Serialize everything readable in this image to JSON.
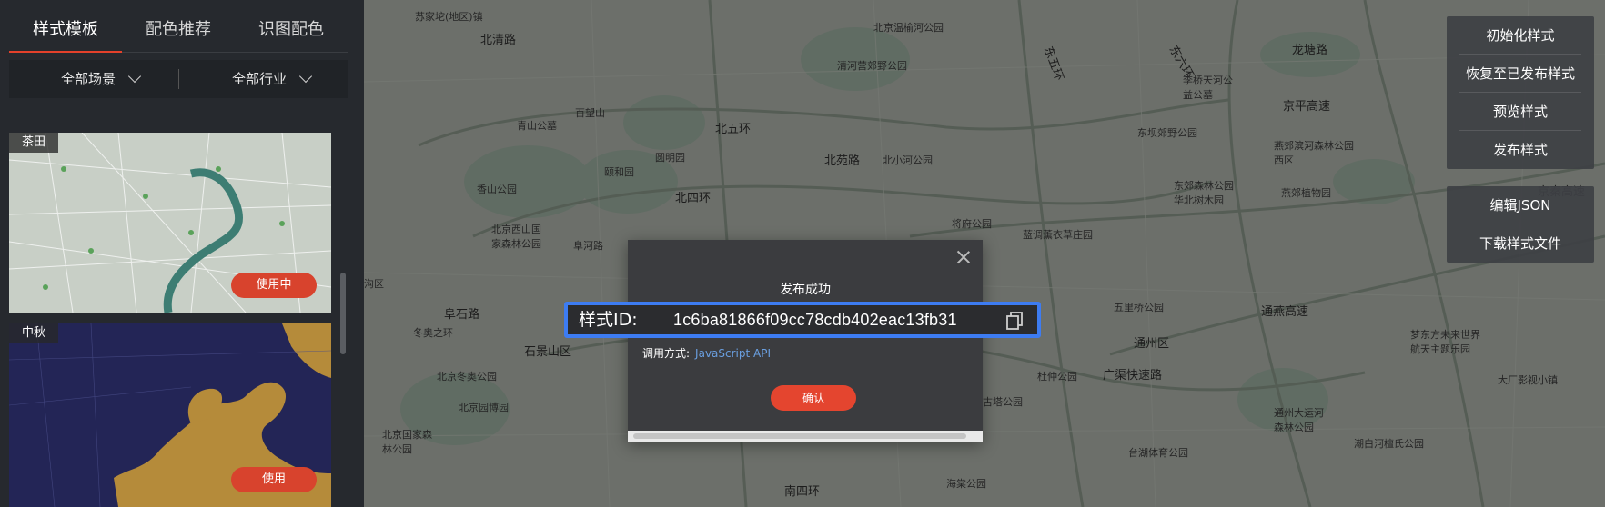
{
  "sidebar": {
    "tabs": [
      {
        "label": "样式模板"
      },
      {
        "label": "配色推荐"
      },
      {
        "label": "识图配色"
      }
    ],
    "filters": [
      {
        "label": "全部场景"
      },
      {
        "label": "全部行业"
      }
    ],
    "cards": [
      {
        "tag": "茶田",
        "button": "使用中"
      },
      {
        "tag": "中秋",
        "button": "使用"
      }
    ]
  },
  "map": {
    "labels": [
      "苏家坨(地区)镇",
      "北清路",
      "百望山",
      "青山公墓",
      "颐和园",
      "圆明园",
      "北五环",
      "北四环",
      "香山公园",
      "北京西山国家森林公园",
      "阜河路",
      "石景山区",
      "冬奥之环",
      "阜石路",
      "北京冬奥公园",
      "北京国家森林公园",
      "北京园博园",
      "北苑路",
      "北小河公园",
      "北京温榆河公园",
      "清河营郊野公园",
      "东坝郊野公园",
      "东郊森林公园",
      "华北树木园",
      "京平高速",
      "龙塘路",
      "李桥天河公益公墓",
      "将府公园",
      "蓝调薰衣草庄园",
      "五里桥公园",
      "通燕高速",
      "通州区",
      "梦东方未来世界航天主题乐园",
      "大厂影视小镇",
      "广渠快速路",
      "杜仲公园",
      "古塔公园",
      "台湖体育公园",
      "海棠公园",
      "南四环",
      "通州大运河森林公园",
      "潮白河檀氏公园",
      "燕郊植物园",
      "京秦高速",
      "燕郊滨河森林公园西区",
      "沟区",
      "东六环",
      "东五环"
    ]
  },
  "panels": {
    "style_actions": [
      "初始化样式",
      "恢复至已发布样式",
      "预览样式",
      "发布样式"
    ],
    "file_actions": [
      "编辑JSON",
      "下载样式文件"
    ]
  },
  "dialog": {
    "title": "发布成功",
    "id_label": "样式ID:",
    "id_value": "1c6ba81866f09cc78cdb402eac13fb31",
    "method_label": "调用方式:",
    "method_value": "JavaScript API",
    "confirm": "确认"
  },
  "colors": {
    "accent": "#e4412b",
    "highlight_border": "#3d7cf2",
    "link": "#6a9fe0"
  }
}
